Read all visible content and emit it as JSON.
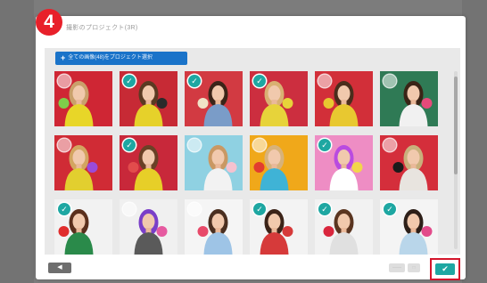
{
  "step_badge": "4",
  "dialog": {
    "title": "撮影のプロジェクト(3R)",
    "select_all_label": "全ての画像(48)をプロジェクト選択"
  },
  "icons": {
    "check": "✓",
    "plus": "+",
    "back": "◀"
  },
  "colors": {
    "accent_blue": "#1a73c9",
    "check_teal": "#1ea7a2",
    "highlight_red": "#d4162b",
    "badge_red": "#e8202a"
  },
  "grid": {
    "rows": [
      [
        {
          "bg": "#cf2634",
          "shirt": "#e8d628",
          "hair": "#caa06b",
          "prop": "#7fce4a",
          "selected": false
        },
        {
          "bg": "#c72a35",
          "shirt": "#e6d12a",
          "hair": "#5b3a22",
          "prop": "#2b2b2b",
          "selected": true
        },
        {
          "bg": "#d23a42",
          "shirt": "#7a9cc8",
          "hair": "#3b2418",
          "prop": "#f0e2c6",
          "selected": true
        },
        {
          "bg": "#cc2e3f",
          "shirt": "#e7d33a",
          "hair": "#d9b072",
          "prop": "#e7d33a",
          "selected": true
        },
        {
          "bg": "#d22f39",
          "shirt": "#e8c830",
          "hair": "#4a2d1c",
          "prop": "#e8c830",
          "selected": false
        },
        {
          "bg": "#2f7a55",
          "shirt": "#f1f1f1",
          "hair": "#3a2416",
          "prop": "#e64a7a",
          "selected": false
        }
      ],
      [
        {
          "bg": "#d02b35",
          "shirt": "#e2cf2f",
          "hair": "#d3a560",
          "prop": "#9a4bd8",
          "selected": false
        },
        {
          "bg": "#c8283a",
          "shirt": "#e7cf28",
          "hair": "#6a4126",
          "prop": "#e24c4c",
          "selected": true
        },
        {
          "bg": "#8fd1e2",
          "shirt": "#f2f2f2",
          "hair": "#c99863",
          "prop": "#f5c2cf",
          "selected": false
        },
        {
          "bg": "#f0a81a",
          "shirt": "#3fb3d6",
          "hair": "#d7b27a",
          "prop": "#e23c2f",
          "selected": false
        },
        {
          "bg": "#ee8dc4",
          "shirt": "#ffffff",
          "hair": "#b94be0",
          "prop": "#f2d64a",
          "selected": true
        },
        {
          "bg": "#d42e3b",
          "shirt": "#e8e4df",
          "hair": "#c9b07c",
          "prop": "#1b1b1b",
          "selected": false
        }
      ],
      [
        {
          "bg": "#f2f2f2",
          "shirt": "#2a8a4a",
          "hair": "#5a2f1c",
          "prop": "#e02d2d",
          "selected": true
        },
        {
          "bg": "#f0f0f0",
          "shirt": "#5a5a5a",
          "hair": "#7a3fc8",
          "prop": "#e65aa0",
          "selected": false
        },
        {
          "bg": "#f5f5f5",
          "shirt": "#9ec4e6",
          "hair": "#4a2f20",
          "prop": "#e84a6a",
          "selected": false
        },
        {
          "bg": "#f3f3f3",
          "shirt": "#d63a3a",
          "hair": "#3b2318",
          "prop": "#d63a3a",
          "selected": true
        },
        {
          "bg": "#f2f2f2",
          "shirt": "#e0e0e0",
          "hair": "#5a3520",
          "prop": "#d9263d",
          "selected": true
        },
        {
          "bg": "#f4f4f4",
          "shirt": "#b9d6ea",
          "hair": "#2d1f18",
          "prop": "#e24a8a",
          "selected": true
        }
      ]
    ]
  },
  "footer": {
    "mini_a": "――",
    "mini_b": "□",
    "ok_icon": "✔"
  }
}
